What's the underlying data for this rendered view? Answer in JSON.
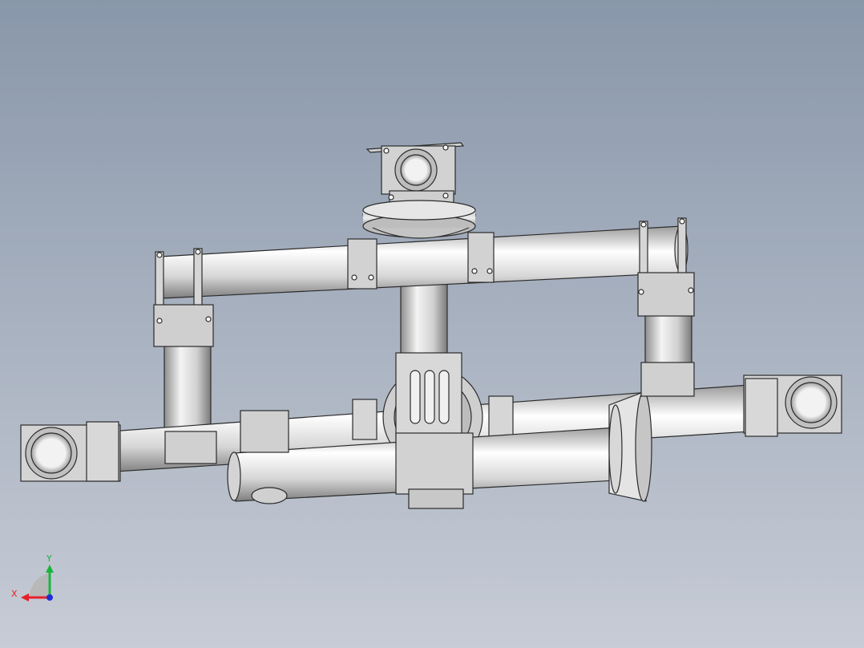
{
  "viewport": {
    "background_top": "#8997aa",
    "background_bottom": "#c7ccd6"
  },
  "triad": {
    "x_label": "X",
    "y_label": "Y",
    "x_color": "#e8202a",
    "y_color": "#18b43a",
    "z_color": "#1c2fd8"
  },
  "model": {
    "part_fill": "#d9d9d9",
    "part_edge": "#2b2b2b",
    "tube_highlight": "#ffffff",
    "tube_shadow": "#8a8a8a"
  }
}
